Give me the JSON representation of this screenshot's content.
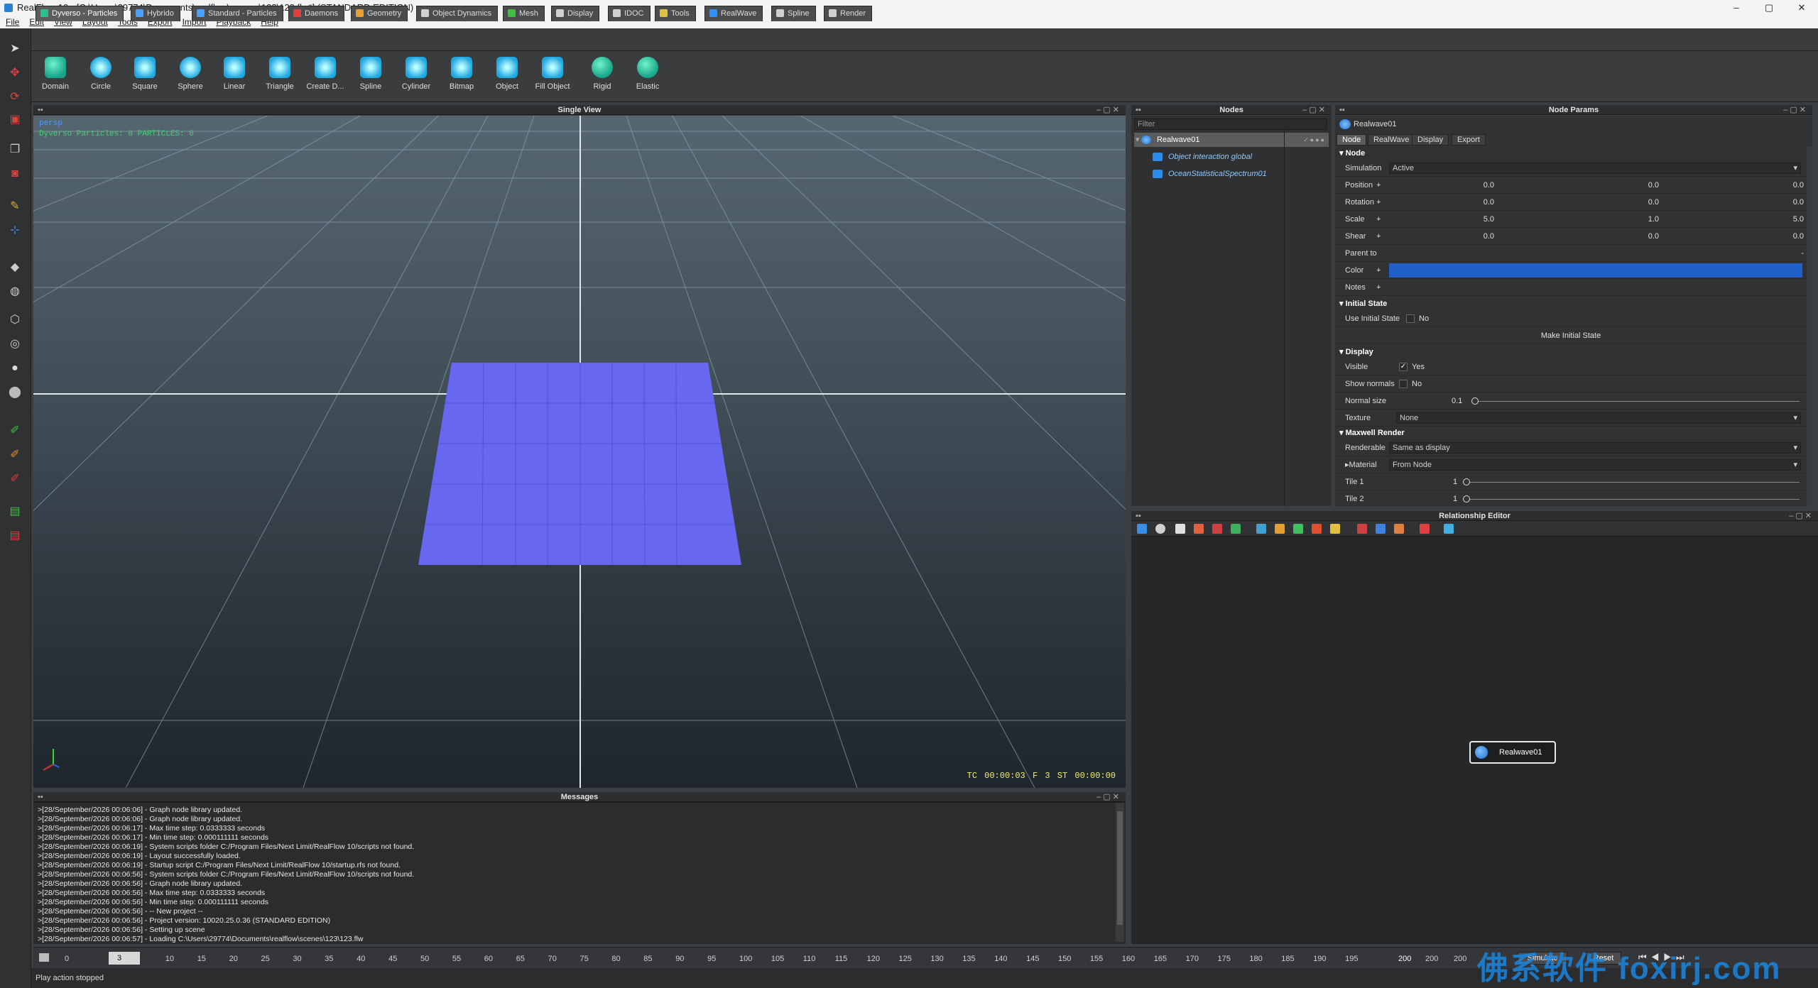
{
  "window": {
    "title": "RealFlow 10 - [C:\\Users\\29774\\Documents\\realflow\\scenes\\123\\123.flw*] (STANDARD EDITION)",
    "min": "–",
    "max": "▢",
    "close": "✕"
  },
  "menu": [
    "File",
    "Edit",
    "View",
    "Layout",
    "Tools",
    "Export",
    "Import",
    "Playback",
    "Help"
  ],
  "toolbar_tabs": [
    {
      "label": "Dyverso - Particles",
      "color": "#29c08a"
    },
    {
      "label": "Hybrido",
      "color": "#4aa0ff"
    },
    {
      "label": "Standard - Particles",
      "color": "#4aa0ff"
    },
    {
      "label": "Daemons",
      "color": "#e04040"
    },
    {
      "label": "Geometry",
      "color": "#e8a030"
    },
    {
      "label": "Object Dynamics",
      "color": "#d0d0d0"
    },
    {
      "label": "Mesh",
      "color": "#40c040"
    },
    {
      "label": "Display",
      "color": "#d0d0d0"
    },
    {
      "label": "IDOC",
      "color": "#d0d0d0"
    },
    {
      "label": "Tools",
      "color": "#e0c040"
    },
    {
      "label": "RealWave",
      "color": "#3090ff"
    },
    {
      "label": "Spline",
      "color": "#d0d0d0"
    },
    {
      "label": "Render",
      "color": "#d0d0d0"
    }
  ],
  "tools": [
    "Domain",
    "Circle",
    "Square",
    "Sphere",
    "Linear",
    "Triangle",
    "Create D...",
    "Spline",
    "Cylinder",
    "Bitmap",
    "Object",
    "Fill Object",
    "Rigid",
    "Elastic"
  ],
  "viewport": {
    "title": "Single View",
    "camera_label": "persp",
    "info_label": "Dyverso Particles: 0 PARTICLES: 0",
    "timecode": "TC 00:00:03",
    "frame": "F 3",
    "sim_time": "ST 00:00:00"
  },
  "messages": {
    "title": "Messages",
    "lines": [
      ">[28/September/2026 00:06:06] - Graph node library updated.",
      ">[28/September/2026 00:06:06] - Graph node library updated.",
      ">[28/September/2026 00:06:17] - Max time step: 0.0333333 seconds",
      ">[28/September/2026 00:06:17] - Min time step: 0.000111111 seconds",
      ">[28/September/2026 00:06:19] - System scripts folder C:/Program Files/Next Limit/RealFlow 10/scripts not found.",
      ">[28/September/2026 00:06:19] - Layout successfully loaded.",
      ">[28/September/2026 00:06:19] - Startup script C:/Program Files/Next Limit/RealFlow 10/startup.rfs not found.",
      ">[28/September/2026 00:06:56] - System scripts folder C:/Program Files/Next Limit/RealFlow 10/scripts not found.",
      ">[28/September/2026 00:06:56] - Graph node library updated.",
      ">[28/September/2026 00:06:56] - Max time step: 0.0333333 seconds",
      ">[28/September/2026 00:06:56] - Min time step: 0.000111111 seconds",
      ">[28/September/2026 00:06:56] - -- New project --",
      ">[28/September/2026 00:06:56] - Project version: 10020.25.0.36 (STANDARD EDITION)",
      ">[28/September/2026 00:06:56] - Setting up scene",
      ">[28/September/2026 00:06:57] - Loading C:\\Users\\29774\\Documents\\realflow\\scenes\\123\\123.flw"
    ]
  },
  "nodes": {
    "title": "Nodes",
    "filter_placeholder": "Filter",
    "root": "Realwave01",
    "children": [
      "Object interaction global",
      "OceanStatisticalSpectrum01"
    ]
  },
  "params": {
    "title": "Node Params",
    "node_name": "Realwave01",
    "tabs": [
      "Node",
      "RealWave",
      "Display",
      "Export"
    ],
    "sections": {
      "node": "Node",
      "initial": "Initial State",
      "display": "Display",
      "maxwell": "Maxwell Render"
    },
    "simulation": {
      "label": "Simulation",
      "value": "Active"
    },
    "position": {
      "label": "Position",
      "x": "0.0",
      "y": "0.0",
      "z": "0.0"
    },
    "rotation": {
      "label": "Rotation",
      "x": "0.0",
      "y": "0.0",
      "z": "0.0"
    },
    "scale": {
      "label": "Scale",
      "x": "5.0",
      "y": "1.0",
      "z": "5.0"
    },
    "shear": {
      "label": "Shear",
      "x": "0.0",
      "y": "0.0",
      "z": "0.0"
    },
    "parent": {
      "label": "Parent to",
      "value": "-"
    },
    "color": {
      "label": "Color",
      "hex": "#1f5fc7"
    },
    "notes": {
      "label": "Notes"
    },
    "use_initial": {
      "label": "Use Initial State",
      "value": "No"
    },
    "make_initial": "Make Initial State",
    "visible": {
      "label": "Visible",
      "value": "Yes"
    },
    "show_normals": {
      "label": "Show normals",
      "value": "No"
    },
    "normal_size": {
      "label": "Normal size",
      "value": "0.1"
    },
    "texture": {
      "label": "Texture",
      "value": "None"
    },
    "renderable": {
      "label": "Renderable",
      "value": "Same as display"
    },
    "material": {
      "label": "Material",
      "value": "From Node"
    },
    "tile1": {
      "label": "Tile 1",
      "value": "1"
    },
    "tile2": {
      "label": "Tile 2",
      "value": "1"
    }
  },
  "relationship": {
    "title": "Relationship Editor",
    "node": "Realwave01"
  },
  "timeline": {
    "start": "0",
    "current": "3",
    "ticks": [
      "0",
      "5",
      "10",
      "15",
      "20",
      "25",
      "30",
      "35",
      "40",
      "45",
      "50",
      "55",
      "60",
      "65",
      "70",
      "75",
      "80",
      "85",
      "90",
      "95",
      "100",
      "105",
      "110",
      "115",
      "120",
      "125",
      "130",
      "135",
      "140",
      "145",
      "150",
      "155",
      "160",
      "165",
      "170",
      "175",
      "180",
      "185",
      "190",
      "195",
      "200"
    ],
    "end": "200",
    "end2": "200",
    "end3": "200",
    "simulate": "Simulate",
    "reset": "Reset"
  },
  "status": "Play action stopped",
  "watermark": "佛系软件 foxirj.com"
}
